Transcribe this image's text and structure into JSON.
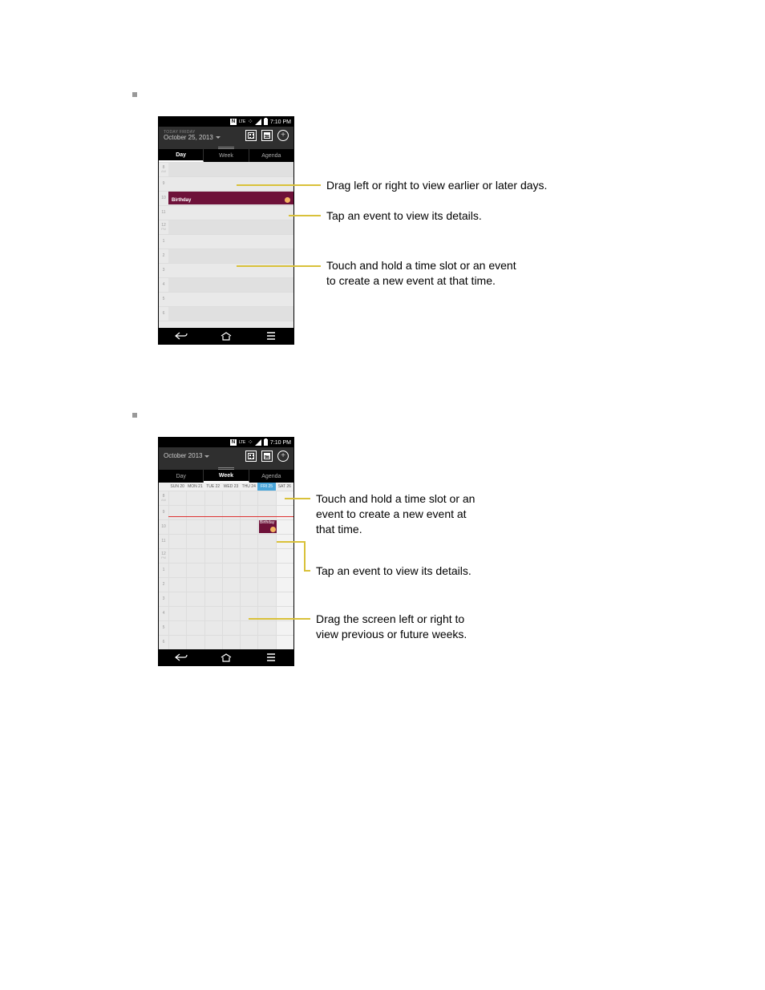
{
  "sections": [
    {
      "phone": {
        "status": {
          "lte_label": "LTE",
          "time": "7:10 PM"
        },
        "header": {
          "subtitle": "TODAY  FRIDAY",
          "title": "October 25, 2013",
          "today_num": "25"
        },
        "tabs": {
          "day": "Day",
          "week": "Week",
          "agenda": "Agenda",
          "active": 0
        },
        "hours_top": [
          "8",
          "AM"
        ],
        "hours": [
          "9",
          "10",
          "11",
          "12",
          "1",
          "2",
          "3",
          "4",
          "5",
          "6"
        ],
        "noon_ampm": "PM",
        "event": {
          "label": "Birthday"
        }
      },
      "callouts": {
        "c1": "Drag left or right to view earlier or later days.",
        "c2": "Tap an event to view its details.",
        "c3a": "Touch and hold a time slot or an event",
        "c3b": "to create a new event at that time."
      }
    },
    {
      "phone": {
        "status": {
          "lte_label": "LTE",
          "time": "7:10 PM"
        },
        "header": {
          "subtitle": "",
          "title": "October 2013",
          "today_num": "25"
        },
        "tabs": {
          "day": "Day",
          "week": "Week",
          "agenda": "Agenda",
          "active": 1
        },
        "week_days": [
          "SUN 20",
          "MON 21",
          "TUE 22",
          "WED 23",
          "THU 24",
          "FRI 25",
          "SAT 26"
        ],
        "hours_top": [
          "8",
          "AM"
        ],
        "hours": [
          "9",
          "10",
          "11",
          "12",
          "1",
          "2",
          "3",
          "4",
          "5",
          "6"
        ],
        "noon_ampm": "PM",
        "event": {
          "label": "Birthday"
        }
      },
      "callouts": {
        "c1a": "Touch and hold a time slot or an",
        "c1b": "event to create a new event at",
        "c1c": "that time.",
        "c2": "Tap an event to view its details.",
        "c3a": "Drag the screen left or right to",
        "c3b": "view previous or future weeks."
      }
    }
  ]
}
